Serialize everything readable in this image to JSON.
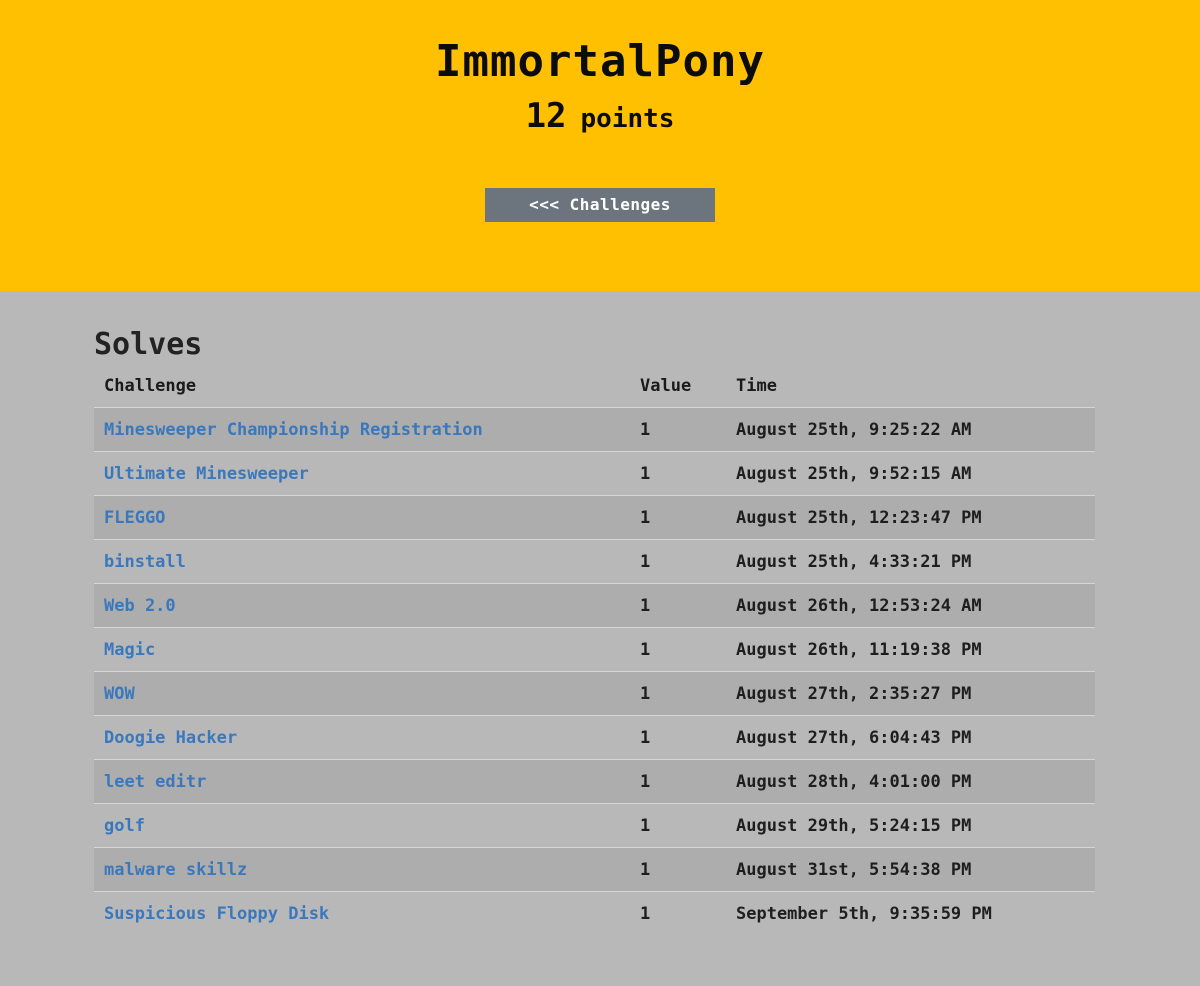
{
  "header": {
    "team_name": "ImmortalPony",
    "score": "12",
    "score_unit": "points",
    "back_button": "<<< Challenges"
  },
  "solves": {
    "title": "Solves",
    "columns": [
      "Challenge",
      "Value",
      "Time"
    ],
    "rows": [
      {
        "challenge": "Minesweeper Championship Registration",
        "value": "1",
        "time": "August 25th, 9:25:22 AM"
      },
      {
        "challenge": "Ultimate Minesweeper",
        "value": "1",
        "time": "August 25th, 9:52:15 AM"
      },
      {
        "challenge": "FLEGGO",
        "value": "1",
        "time": "August 25th, 12:23:47 PM"
      },
      {
        "challenge": "binstall",
        "value": "1",
        "time": "August 25th, 4:33:21 PM"
      },
      {
        "challenge": "Web 2.0",
        "value": "1",
        "time": "August 26th, 12:53:24 AM"
      },
      {
        "challenge": "Magic",
        "value": "1",
        "time": "August 26th, 11:19:38 PM"
      },
      {
        "challenge": "WOW",
        "value": "1",
        "time": "August 27th, 2:35:27 PM"
      },
      {
        "challenge": "Doogie Hacker",
        "value": "1",
        "time": "August 27th, 6:04:43 PM"
      },
      {
        "challenge": "leet editr",
        "value": "1",
        "time": "August 28th, 4:01:00 PM"
      },
      {
        "challenge": "golf",
        "value": "1",
        "time": "August 29th, 5:24:15 PM"
      },
      {
        "challenge": "malware skillz",
        "value": "1",
        "time": "August 31st, 5:54:38 PM"
      },
      {
        "challenge": "Suspicious Floppy Disk",
        "value": "1",
        "time": "September 5th, 9:35:59 PM"
      }
    ]
  },
  "colors": {
    "header_bg": "#fec000",
    "page_bg": "#b8b8b8",
    "stripe_bg": "#adadad",
    "link": "#3a78bd",
    "button_bg": "#6c757d"
  }
}
